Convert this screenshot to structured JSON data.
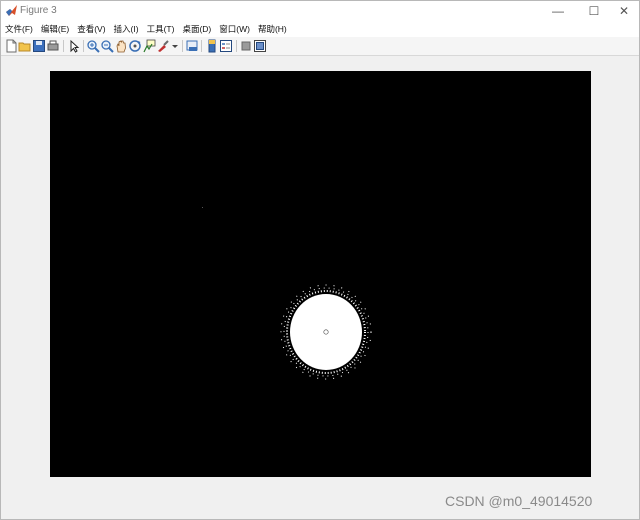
{
  "window": {
    "title": "Figure 3",
    "controls": {
      "minimize": "—",
      "maximize": "☐",
      "close": "✕"
    }
  },
  "menubar": {
    "items": [
      {
        "label": "文件(F)"
      },
      {
        "label": "编辑(E)"
      },
      {
        "label": "查看(V)"
      },
      {
        "label": "插入(I)"
      },
      {
        "label": "工具(T)"
      },
      {
        "label": "桌面(D)"
      },
      {
        "label": "窗口(W)"
      },
      {
        "label": "帮助(H)"
      }
    ]
  },
  "toolbar": {
    "icons": [
      "new-figure-icon",
      "open-file-icon",
      "save-icon",
      "print-icon",
      "pointer-icon",
      "zoom-in-icon",
      "zoom-out-icon",
      "pan-icon",
      "rotate-icon",
      "data-cursor-icon",
      "brush-icon",
      "link-plot-icon",
      "insert-colorbar-icon",
      "insert-legend-icon",
      "hide-plot-tools-icon",
      "show-plot-tools-icon"
    ]
  },
  "figure": {
    "colors": {
      "background": "#000000",
      "blob": "#ffffff"
    }
  },
  "watermark": "CSDN @m0_49014520"
}
